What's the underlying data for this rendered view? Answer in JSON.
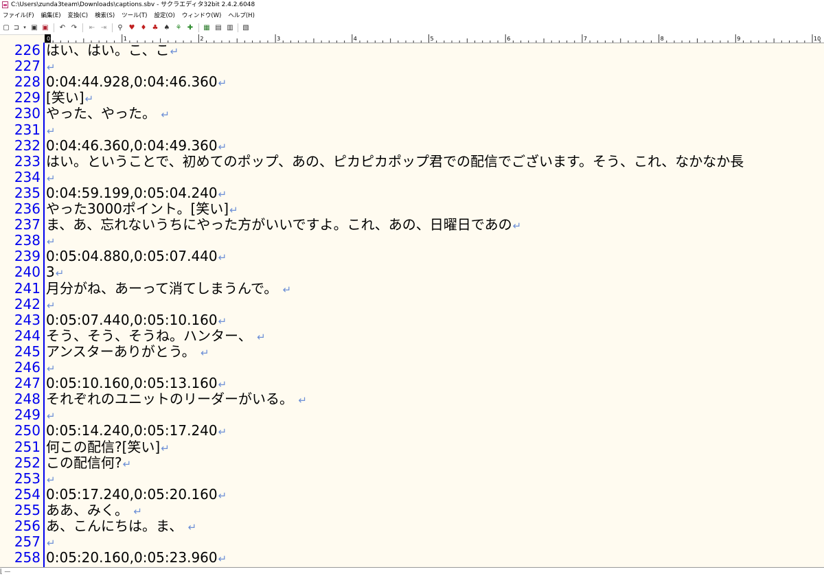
{
  "window": {
    "title": "C:\\Users\\zunda3team\\Downloads\\captions.sbv - サクラエディタ32bit 2.4.2.6048"
  },
  "menu": [
    "ファイル(F)",
    "編集(E)",
    "変換(C)",
    "検索(S)",
    "ツール(T)",
    "設定(O)",
    "ウィンドウ(W)",
    "ヘルプ(H)"
  ],
  "ruler": {
    "labels": [
      "0",
      "1",
      "2",
      "3",
      "4",
      "5",
      "6",
      "7",
      "8",
      "9",
      "10"
    ]
  },
  "editor": {
    "lines": [
      {
        "num": "226",
        "text": "はい、はい。こ、こ"
      },
      {
        "num": "227",
        "text": ""
      },
      {
        "num": "228",
        "text": "0:04:44.928,0:04:46.360"
      },
      {
        "num": "229",
        "text": "[笑い]"
      },
      {
        "num": "230",
        "text": "やった、やった。 "
      },
      {
        "num": "231",
        "text": ""
      },
      {
        "num": "232",
        "text": "0:04:46.360,0:04:49.360"
      },
      {
        "num": "233",
        "text": "はい。ということで、初めてのポップ、あの、ピカピカポップ君での配信でございます。そう、これ、なかなか長"
      },
      {
        "num": "234",
        "text": ""
      },
      {
        "num": "235",
        "text": "0:04:59.199,0:05:04.240"
      },
      {
        "num": "236",
        "text": "やった3000ポイント。[笑い]"
      },
      {
        "num": "237",
        "text": "ま、あ、忘れないうちにやった方がいいですよ。これ、あの、日曜日であの"
      },
      {
        "num": "238",
        "text": ""
      },
      {
        "num": "239",
        "text": "0:05:04.880,0:05:07.440"
      },
      {
        "num": "240",
        "text": "3"
      },
      {
        "num": "241",
        "text": "月分がね、あーって消てしまうんで。 "
      },
      {
        "num": "242",
        "text": ""
      },
      {
        "num": "243",
        "text": "0:05:07.440,0:05:10.160"
      },
      {
        "num": "244",
        "text": "そう、そう、そうね。ハンター、 "
      },
      {
        "num": "245",
        "text": "アンスターありがとう。 "
      },
      {
        "num": "246",
        "text": ""
      },
      {
        "num": "247",
        "text": "0:05:10.160,0:05:13.160"
      },
      {
        "num": "248",
        "text": "それぞれのユニットのリーダーがいる。 "
      },
      {
        "num": "249",
        "text": ""
      },
      {
        "num": "250",
        "text": "0:05:14.240,0:05:17.240"
      },
      {
        "num": "251",
        "text": "何この配信?[笑い]"
      },
      {
        "num": "252",
        "text": "この配信何?"
      },
      {
        "num": "253",
        "text": ""
      },
      {
        "num": "254",
        "text": "0:05:17.240,0:05:20.160"
      },
      {
        "num": "255",
        "text": "ああ、みく。 "
      },
      {
        "num": "256",
        "text": "あ、こんにちは。ま、 "
      },
      {
        "num": "257",
        "text": ""
      },
      {
        "num": "258",
        "text": "0:05:20.160,0:05:23.960"
      }
    ]
  },
  "colors": {
    "background": "#fffbf0",
    "line_number": "#0000ee",
    "return_mark": "#6b8ed6"
  }
}
